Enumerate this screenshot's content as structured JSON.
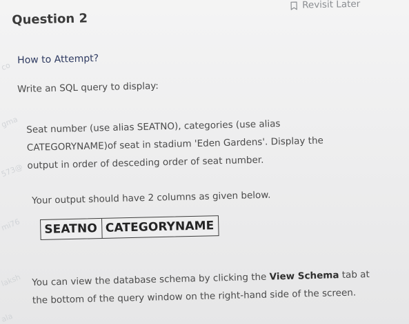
{
  "watermarks": [
    "co",
    "gma",
    "573@",
    "mi76",
    "laksh",
    "ala"
  ],
  "header": {
    "revisit_label": "Revisit Later",
    "question_title": "Question 2"
  },
  "content": {
    "how_to_attempt": "How to Attempt?",
    "instruction": "Write an SQL query to display:",
    "paragraph_lines": [
      "Seat number (use alias SEATNO), categories (use alias",
      "CATEGORYNAME)of seat in stadium 'Eden Gardens'. Display the",
      "output in order of desceding order of seat number."
    ],
    "output_note": "Your output should have 2 columns as given below.",
    "columns": [
      "SEATNO",
      "CATEGORYNAME"
    ],
    "schema_note": {
      "line1_prefix": "You can view the database schema by clicking the ",
      "line1_link": "View Schema",
      "line1_suffix": " tab at",
      "line2": "the bottom of the query window on the right-hand side of the screen."
    }
  },
  "colors": {
    "background": "#ebebec",
    "heading": "#3b3b3b",
    "subheading": "#2f3b61",
    "body_text": "#4a4a4a",
    "muted_text": "#8a8d91",
    "watermark": "#cfd2d6",
    "table_border": "#3d3d3d"
  },
  "icons": {
    "revisit": "bookmark-icon"
  }
}
